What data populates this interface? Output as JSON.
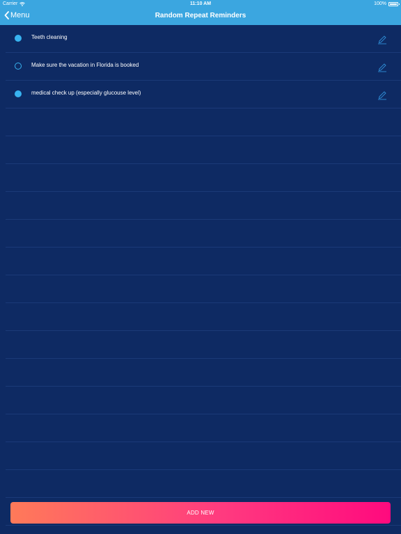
{
  "status_bar": {
    "carrier": "Carrier",
    "time": "11:10 AM",
    "battery": "100%"
  },
  "nav": {
    "back_label": "Menu",
    "title": "Random Repeat Reminders"
  },
  "reminders": [
    {
      "label": "Teeth cleaning",
      "active": true
    },
    {
      "label": "Make sure the vacation in Florida is booked",
      "active": false
    },
    {
      "label": "medical check up (especially glucouse level)",
      "active": true
    }
  ],
  "add_button": {
    "label": "ADD NEW"
  },
  "colors": {
    "header": "#3ba6e0",
    "background": "#0e2a63",
    "accent": "#38b3f0",
    "button_start": "#ff7a59",
    "button_end": "#ff0a7e"
  }
}
